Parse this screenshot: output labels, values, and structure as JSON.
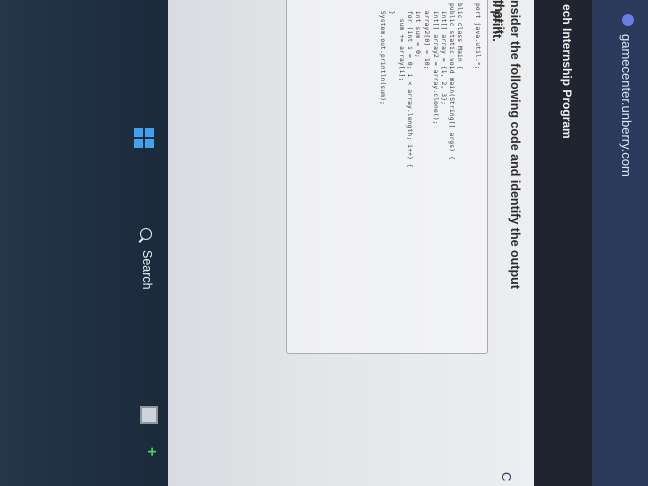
{
  "browser": {
    "url": "gamecenter.unberry.com"
  },
  "site": {
    "title": "ech Internship Program"
  },
  "question": {
    "line1": "nsider the following code and identify the output that it",
    "line2": "ll print.",
    "corner_letter": "C"
  },
  "code_lines": [
    "port java.util.*;",
    "blic class Main {",
    "public static void main(String[] args) {",
    "  int[] array = {1, 2, 3};",
    "  int[] array2 = array.clone();",
    "  array2[0] = 10;",
    "  int sum = 0;",
    "  for (int i = 0; i < array.length; i++) {",
    "    sum += array[i];",
    "  }",
    "  System.out.println(sum);"
  ],
  "taskbar": {
    "search_label": "Search",
    "windows_color": "#3fa2ef",
    "tray_plus_color": "#47d068"
  }
}
